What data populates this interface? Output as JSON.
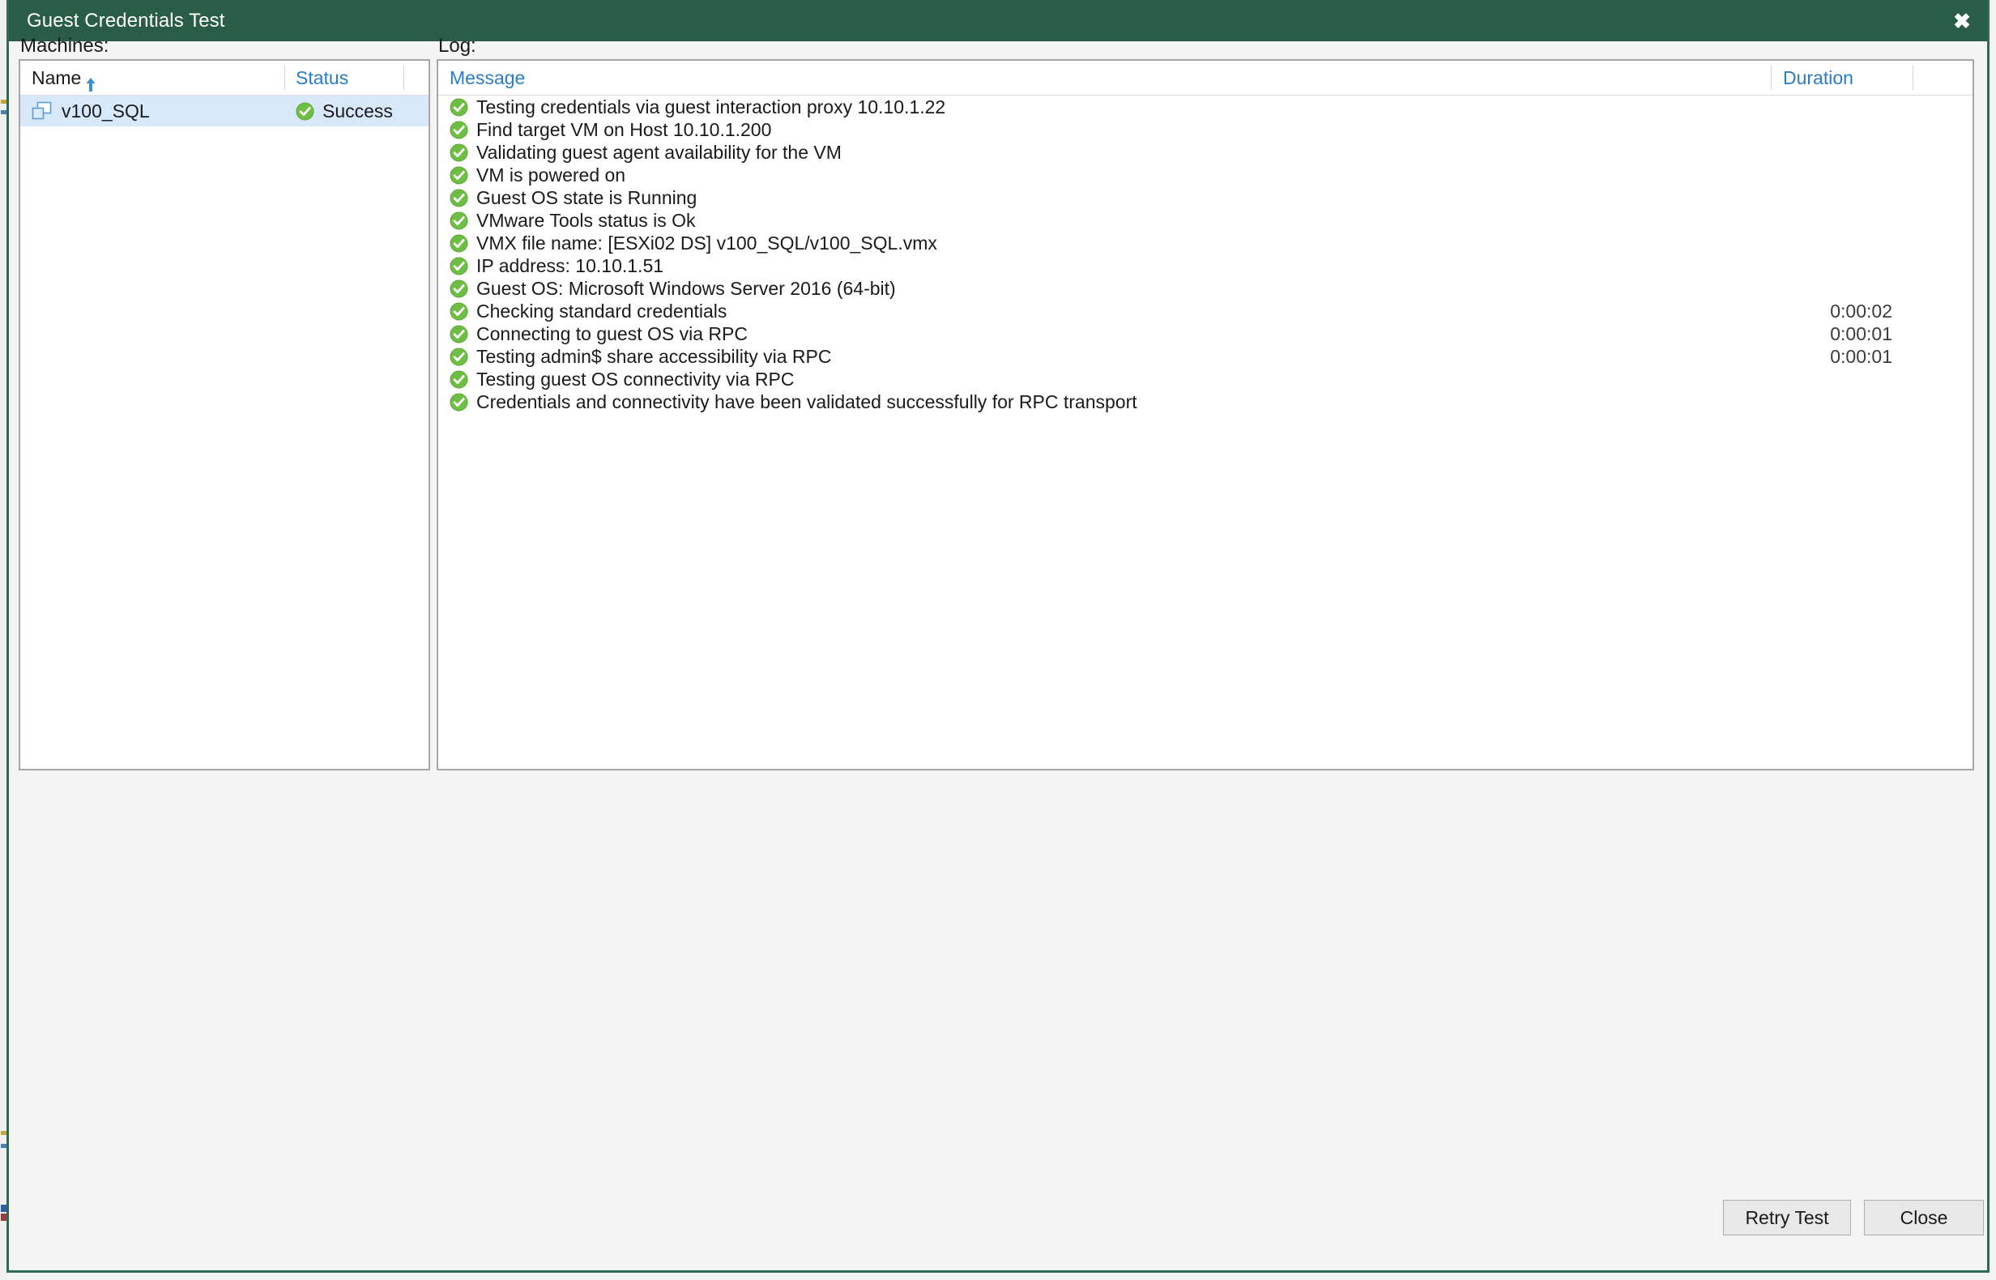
{
  "window": {
    "title": "Guest Credentials Test",
    "close_icon": "close-icon",
    "close_glyph": "✖",
    "title_bar_color": "#2a5d47"
  },
  "machines": {
    "label": "Machines:",
    "columns": [
      {
        "key": "name",
        "label": "Name",
        "sort": "ascending",
        "sort_icon": "sort-ascending-icon"
      },
      {
        "key": "status",
        "label": "Status"
      }
    ],
    "rows": [
      {
        "name": "v100_SQL",
        "icon": "virtual-machine-icon",
        "status": "Success",
        "status_icon": "success-check-icon",
        "selected": true
      }
    ]
  },
  "log": {
    "label": "Log:",
    "columns": [
      {
        "key": "message",
        "label": "Message"
      },
      {
        "key": "duration",
        "label": "Duration"
      }
    ],
    "rows": [
      {
        "icon": "success-check-icon",
        "message": "Testing credentials via guest interaction proxy 10.10.1.22",
        "duration": ""
      },
      {
        "icon": "success-check-icon",
        "message": "Find target VM on Host 10.10.1.200",
        "duration": ""
      },
      {
        "icon": "success-check-icon",
        "message": "Validating guest agent availability for the VM",
        "duration": ""
      },
      {
        "icon": "success-check-icon",
        "message": "VM is powered on",
        "duration": ""
      },
      {
        "icon": "success-check-icon",
        "message": "Guest OS state is Running",
        "duration": ""
      },
      {
        "icon": "success-check-icon",
        "message": "VMware Tools status is Ok",
        "duration": ""
      },
      {
        "icon": "success-check-icon",
        "message": "VMX file name: [ESXi02 DS] v100_SQL/v100_SQL.vmx",
        "duration": ""
      },
      {
        "icon": "success-check-icon",
        "message": "IP address: 10.10.1.51",
        "duration": ""
      },
      {
        "icon": "success-check-icon",
        "message": "Guest OS: Microsoft Windows Server 2016 (64-bit)",
        "duration": ""
      },
      {
        "icon": "success-check-icon",
        "message": "Checking standard credentials",
        "duration": "0:00:02"
      },
      {
        "icon": "success-check-icon",
        "message": "Connecting to guest OS via RPC",
        "duration": "0:00:01"
      },
      {
        "icon": "success-check-icon",
        "message": "Testing admin$ share accessibility via RPC",
        "duration": "0:00:01"
      },
      {
        "icon": "success-check-icon",
        "message": "Testing guest OS connectivity via RPC",
        "duration": ""
      },
      {
        "icon": "success-check-icon",
        "message": "Credentials and connectivity have been validated successfully for RPC transport",
        "duration": ""
      }
    ]
  },
  "footer": {
    "retry_label": "Retry Test",
    "close_label": "Close"
  },
  "colors": {
    "title_bar": "#2a5d47",
    "dialog_border": "#2f6b52",
    "header_link": "#2a7cc7",
    "success_green": "#6fbe44",
    "selection_blue": "#d8e8fb",
    "vm_icon_blue": "#5b9bd5"
  }
}
